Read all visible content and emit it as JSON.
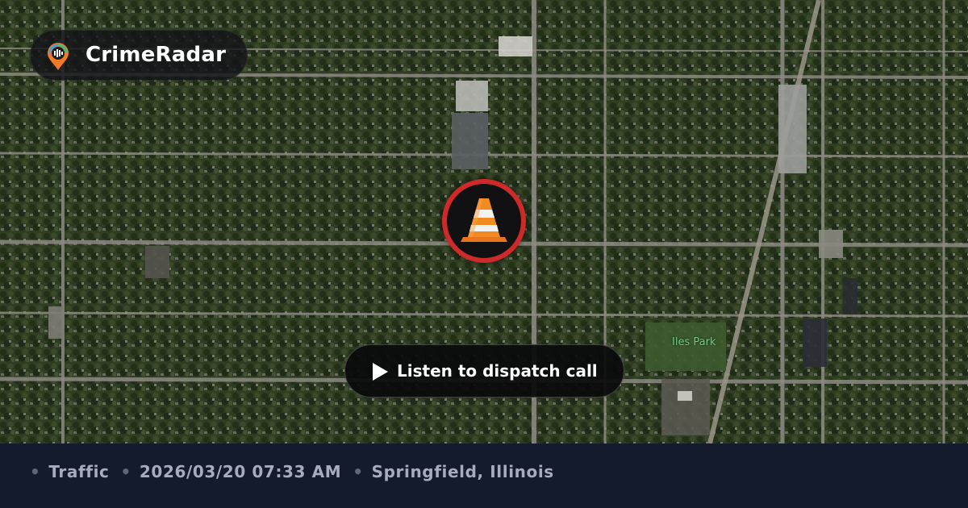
{
  "brand": {
    "name": "CrimeRadar",
    "logo_icon": "map-pin-radio-icon"
  },
  "map": {
    "type": "satellite",
    "park_label": "Iles Park",
    "incident_marker": {
      "icon": "traffic-cone-icon",
      "ring_color": "#cf2a2a"
    }
  },
  "player": {
    "label": "Listen to dispatch call",
    "icon": "play-icon"
  },
  "footer": {
    "category": "Traffic",
    "datetime": "2026/03/20 07:33 AM",
    "location": "Springfield, Illinois",
    "separator": "•"
  },
  "colors": {
    "accent": "#cf2a2a",
    "footer_bg": "#141b2d",
    "footer_text": "#a7adbb"
  }
}
